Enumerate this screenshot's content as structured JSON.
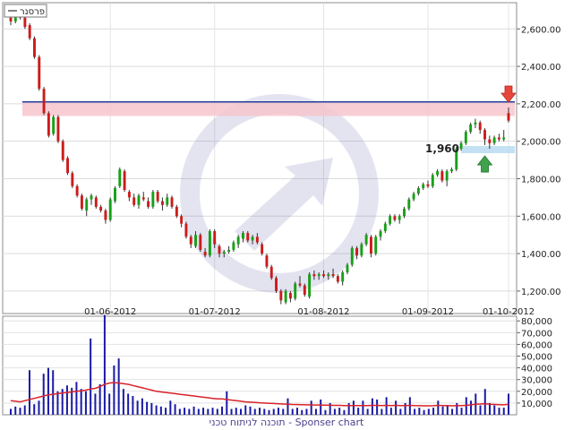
{
  "chart_data": [
    {
      "type": "candlestick",
      "legend": "פרסנר",
      "yticks": [
        1200,
        1400,
        1600,
        1800,
        2000,
        2200,
        2400,
        2600
      ],
      "ytick_labels": [
        "1,200.00",
        "1,400.00",
        "1,600.00",
        "1,800.00",
        "2,000.00",
        "2,200.00",
        "2,400.00",
        "2,600.00"
      ],
      "ylim": [
        1080,
        2740
      ],
      "date_ticks": [
        {
          "label": "01-06-2012",
          "index": 21
        },
        {
          "label": "01-07-2012",
          "index": 43
        },
        {
          "label": "01-08-2012",
          "index": 66
        },
        {
          "label": "01-09-2012",
          "index": 88
        },
        {
          "label": "01-10-2012",
          "index": 105
        }
      ],
      "resistance_level": 2210,
      "support_level": 1960,
      "support_label": "1,960",
      "ohlc": [
        [
          2660,
          2680,
          2620,
          2640
        ],
        [
          2640,
          2700,
          2630,
          2690
        ],
        [
          2690,
          2700,
          2650,
          2660
        ],
        [
          2660,
          2670,
          2600,
          2610
        ],
        [
          2620,
          2630,
          2540,
          2550
        ],
        [
          2550,
          2560,
          2440,
          2450
        ],
        [
          2450,
          2460,
          2270,
          2280
        ],
        [
          2280,
          2290,
          2140,
          2150
        ],
        [
          2150,
          2160,
          2020,
          2030
        ],
        [
          2040,
          2140,
          2030,
          2130
        ],
        [
          2130,
          2140,
          1990,
          2000
        ],
        [
          2000,
          2010,
          1890,
          1900
        ],
        [
          1910,
          1920,
          1820,
          1830
        ],
        [
          1830,
          1840,
          1750,
          1760
        ],
        [
          1760,
          1770,
          1700,
          1710
        ],
        [
          1710,
          1720,
          1630,
          1640
        ],
        [
          1630,
          1700,
          1600,
          1690
        ],
        [
          1690,
          1720,
          1660,
          1710
        ],
        [
          1700,
          1710,
          1640,
          1650
        ],
        [
          1650,
          1660,
          1620,
          1630
        ],
        [
          1630,
          1640,
          1560,
          1580
        ],
        [
          1580,
          1700,
          1570,
          1690
        ],
        [
          1680,
          1760,
          1670,
          1750
        ],
        [
          1760,
          1860,
          1750,
          1850
        ],
        [
          1840,
          1850,
          1730,
          1740
        ],
        [
          1730,
          1740,
          1680,
          1700
        ],
        [
          1700,
          1720,
          1650,
          1660
        ],
        [
          1660,
          1720,
          1640,
          1710
        ],
        [
          1700,
          1730,
          1680,
          1690
        ],
        [
          1680,
          1700,
          1640,
          1650
        ],
        [
          1650,
          1740,
          1640,
          1730
        ],
        [
          1730,
          1740,
          1670,
          1680
        ],
        [
          1680,
          1700,
          1630,
          1660
        ],
        [
          1660,
          1720,
          1650,
          1700
        ],
        [
          1700,
          1710,
          1640,
          1650
        ],
        [
          1650,
          1660,
          1590,
          1600
        ],
        [
          1600,
          1610,
          1540,
          1560
        ],
        [
          1560,
          1570,
          1480,
          1490
        ],
        [
          1490,
          1500,
          1430,
          1450
        ],
        [
          1440,
          1520,
          1430,
          1500
        ],
        [
          1500,
          1510,
          1410,
          1420
        ],
        [
          1410,
          1430,
          1380,
          1390
        ],
        [
          1390,
          1530,
          1380,
          1520
        ],
        [
          1520,
          1530,
          1430,
          1450
        ],
        [
          1440,
          1450,
          1380,
          1400
        ],
        [
          1400,
          1420,
          1380,
          1410
        ],
        [
          1410,
          1440,
          1400,
          1420
        ],
        [
          1420,
          1470,
          1410,
          1460
        ],
        [
          1450,
          1500,
          1430,
          1490
        ],
        [
          1480,
          1520,
          1460,
          1510
        ],
        [
          1510,
          1520,
          1460,
          1470
        ],
        [
          1470,
          1500,
          1450,
          1490
        ],
        [
          1490,
          1510,
          1450,
          1460
        ],
        [
          1450,
          1460,
          1390,
          1400
        ],
        [
          1390,
          1400,
          1320,
          1330
        ],
        [
          1330,
          1340,
          1260,
          1270
        ],
        [
          1270,
          1280,
          1190,
          1200
        ],
        [
          1200,
          1210,
          1130,
          1150
        ],
        [
          1140,
          1210,
          1130,
          1200
        ],
        [
          1190,
          1200,
          1140,
          1160
        ],
        [
          1160,
          1250,
          1150,
          1240
        ],
        [
          1240,
          1280,
          1220,
          1230
        ],
        [
          1230,
          1240,
          1170,
          1180
        ],
        [
          1170,
          1300,
          1160,
          1290
        ],
        [
          1290,
          1310,
          1260,
          1280
        ],
        [
          1280,
          1300,
          1260,
          1290
        ],
        [
          1290,
          1310,
          1270,
          1280
        ],
        [
          1280,
          1300,
          1260,
          1290
        ],
        [
          1290,
          1320,
          1270,
          1280
        ],
        [
          1280,
          1290,
          1240,
          1250
        ],
        [
          1250,
          1310,
          1230,
          1300
        ],
        [
          1300,
          1350,
          1290,
          1340
        ],
        [
          1340,
          1440,
          1330,
          1430
        ],
        [
          1430,
          1440,
          1370,
          1390
        ],
        [
          1390,
          1460,
          1380,
          1450
        ],
        [
          1450,
          1510,
          1440,
          1500
        ],
        [
          1490,
          1500,
          1380,
          1400
        ],
        [
          1400,
          1500,
          1390,
          1490
        ],
        [
          1490,
          1530,
          1470,
          1520
        ],
        [
          1520,
          1570,
          1510,
          1560
        ],
        [
          1560,
          1610,
          1550,
          1600
        ],
        [
          1600,
          1610,
          1570,
          1580
        ],
        [
          1580,
          1610,
          1560,
          1600
        ],
        [
          1600,
          1650,
          1590,
          1640
        ],
        [
          1640,
          1700,
          1630,
          1690
        ],
        [
          1690,
          1730,
          1680,
          1720
        ],
        [
          1720,
          1760,
          1710,
          1750
        ],
        [
          1750,
          1780,
          1740,
          1770
        ],
        [
          1770,
          1790,
          1750,
          1760
        ],
        [
          1760,
          1830,
          1750,
          1820
        ],
        [
          1820,
          1850,
          1810,
          1840
        ],
        [
          1840,
          1850,
          1780,
          1790
        ],
        [
          1790,
          1850,
          1760,
          1840
        ],
        [
          1840,
          1860,
          1830,
          1850
        ],
        [
          1850,
          1970,
          1840,
          1960
        ],
        [
          1960,
          2000,
          1950,
          1990
        ],
        [
          1990,
          2060,
          1980,
          2050
        ],
        [
          2050,
          2100,
          2040,
          2090
        ],
        [
          2090,
          2120,
          2070,
          2100
        ],
        [
          2100,
          2110,
          2040,
          2060
        ],
        [
          2060,
          2070,
          1980,
          2010
        ],
        [
          2010,
          2030,
          1960,
          1990
        ],
        [
          1990,
          2030,
          1980,
          2020
        ],
        [
          2020,
          2040,
          2000,
          2010
        ],
        [
          2010,
          2060,
          2000,
          2020
        ],
        [
          2150,
          2180,
          2100,
          2110
        ]
      ]
    },
    {
      "type": "bar",
      "yticks": [
        10000,
        20000,
        30000,
        40000,
        50000,
        60000,
        70000,
        80000
      ],
      "ytick_labels": [
        "10,000",
        "20,000",
        "30,000",
        "40,000",
        "50,000",
        "60,000",
        "70,000",
        "80,000"
      ],
      "ylim": [
        0,
        84000
      ],
      "volume": [
        5000,
        7000,
        6000,
        8000,
        38000,
        9000,
        12000,
        35000,
        40000,
        38000,
        20000,
        22000,
        25000,
        23000,
        28000,
        22000,
        20000,
        65000,
        18000,
        26000,
        85000,
        18000,
        42000,
        48000,
        22000,
        18000,
        16000,
        12000,
        14000,
        11000,
        10000,
        8000,
        7000,
        6000,
        12000,
        9000,
        5000,
        6000,
        5000,
        7000,
        5000,
        6000,
        5000,
        6000,
        5000,
        7000,
        20000,
        5000,
        6000,
        5000,
        8000,
        7000,
        5000,
        6000,
        5000,
        4000,
        5000,
        6000,
        5000,
        14000,
        5000,
        6000,
        4000,
        5000,
        12000,
        5000,
        13000,
        4000,
        10000,
        5000,
        6000,
        4000,
        10000,
        12000,
        6000,
        12000,
        5000,
        14000,
        13000,
        5000,
        15000,
        6000,
        12000,
        5000,
        10000,
        15000,
        5000,
        6000,
        4000,
        5000,
        6000,
        12000,
        7000,
        8000,
        5000,
        10000,
        6000,
        15000,
        12000,
        18000,
        8000,
        22000,
        10000,
        8000,
        6000,
        6000,
        18000
      ],
      "moving_average": [
        12000,
        11500,
        11000,
        12000,
        13000,
        14000,
        15000,
        16000,
        17000,
        17500,
        18000,
        18500,
        19000,
        19500,
        20000,
        20500,
        21000,
        22000,
        22500,
        24000,
        26000,
        27000,
        27500,
        27000,
        26500,
        26000,
        25000,
        24000,
        23000,
        22000,
        21000,
        20000,
        19500,
        19000,
        18500,
        18000,
        17500,
        17000,
        16500,
        16000,
        15500,
        15000,
        14500,
        14000,
        13500,
        13500,
        13000,
        12500,
        12000,
        11500,
        11000,
        10800,
        10500,
        10200,
        10000,
        9800,
        9600,
        9400,
        9200,
        9000,
        8800,
        8700,
        8600,
        8500,
        8400,
        8300,
        8300,
        8200,
        8100,
        8000,
        8000,
        7900,
        7900,
        7800,
        7800,
        7900,
        7800,
        8000,
        8000,
        7800,
        8000,
        7800,
        8000,
        7800,
        7800,
        8000,
        7800,
        7700,
        7600,
        7600,
        7700,
        8000,
        7800,
        7800,
        7600,
        7800,
        7800,
        8000,
        8500,
        9000,
        9200,
        9500,
        9000,
        8800,
        8600,
        8500,
        9000
      ]
    }
  ],
  "footer_text": "תוכנה לניתוח טכני - Sponser chart"
}
